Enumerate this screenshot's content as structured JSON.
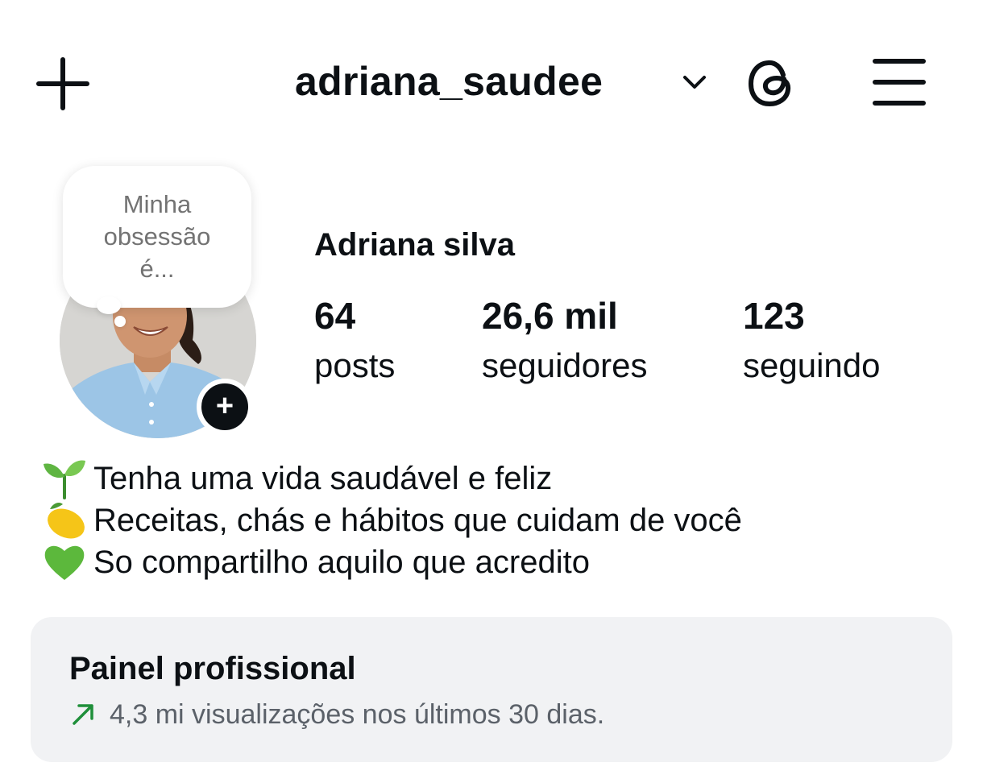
{
  "header": {
    "username": "adriana_saudee",
    "icons": {
      "create": "plus-icon",
      "switch_account": "chevron-down-icon",
      "threads": "threads-icon",
      "menu": "hamburger-menu-icon"
    }
  },
  "note": {
    "text": "Minha\nobsessão\né..."
  },
  "profile": {
    "full_name": "Adriana silva",
    "stats": {
      "posts": {
        "value": "64",
        "label": "posts"
      },
      "followers": {
        "value": "26,6 mil",
        "label": "seguidores"
      },
      "following": {
        "value": "123",
        "label": "seguindo"
      }
    }
  },
  "bio": {
    "lines": [
      {
        "emoji": "seedling-emoji",
        "text": "Tenha uma vida saudável e feliz"
      },
      {
        "emoji": "lemon-emoji",
        "text": "Receitas, chás e hábitos que cuidam de você"
      },
      {
        "emoji": "green-heart-emoji",
        "text": "So compartilho aquilo que acredito"
      }
    ]
  },
  "dashboard": {
    "title": "Painel profissional",
    "subtitle": "4,3 mi visualizações nos últimos 30 dias.",
    "trend_color": "#1f8f3a"
  }
}
